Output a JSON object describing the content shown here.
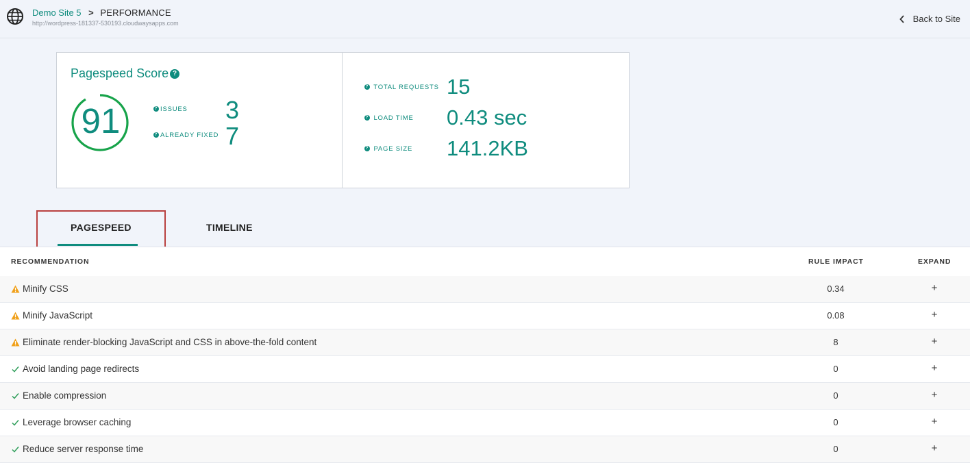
{
  "header": {
    "site_name": "Demo Site 5",
    "separator": ">",
    "page_name": "PERFORMANCE",
    "site_url": "http://wordpress-181337-530193.cloudwaysapps.com",
    "back_label": "Back to Site",
    "icons": [
      "globe-icon",
      "chevron-right-icon",
      "chevron-left-icon"
    ]
  },
  "score_card": {
    "title": "Pagespeed Score",
    "help_glyph": "?",
    "score": "91",
    "score_fraction": 0.91,
    "issues_label": "ISSUES",
    "issues_value": "3",
    "fixed_label": "ALREADY FIXED",
    "fixed_value": "7",
    "total_requests_label": "TOTAL REQUESTS",
    "total_requests_value": "15",
    "load_time_label": "LOAD TIME",
    "load_time_value": "0.43 sec",
    "page_size_label": "PAGE SIZE",
    "page_size_value": "141.2KB"
  },
  "tabs": [
    {
      "label": "PAGESPEED",
      "active": true
    },
    {
      "label": "TIMELINE",
      "active": false
    }
  ],
  "table": {
    "columns": {
      "recommendation": "RECOMMENDATION",
      "rule_impact": "RULE IMPACT",
      "expand": "EXPAND"
    },
    "rows": [
      {
        "status": "warning",
        "text": "Minify CSS",
        "impact": "0.34",
        "expand": "+"
      },
      {
        "status": "warning",
        "text": "Minify JavaScript",
        "impact": "0.08",
        "expand": "+"
      },
      {
        "status": "warning",
        "text": "Eliminate render-blocking JavaScript and CSS in above-the-fold content",
        "impact": "8",
        "expand": "+"
      },
      {
        "status": "pass",
        "text": "Avoid landing page redirects",
        "impact": "0",
        "expand": "+"
      },
      {
        "status": "pass",
        "text": "Enable compression",
        "impact": "0",
        "expand": "+"
      },
      {
        "status": "pass",
        "text": "Leverage browser caching",
        "impact": "0",
        "expand": "+"
      },
      {
        "status": "pass",
        "text": "Reduce server response time",
        "impact": "0",
        "expand": "+"
      }
    ]
  },
  "colors": {
    "accent": "#0f8c7e",
    "ring": "#17a34a",
    "warning": "#f0a01a",
    "pass": "#2f9e5a",
    "highlight_box": "#b9403f"
  }
}
